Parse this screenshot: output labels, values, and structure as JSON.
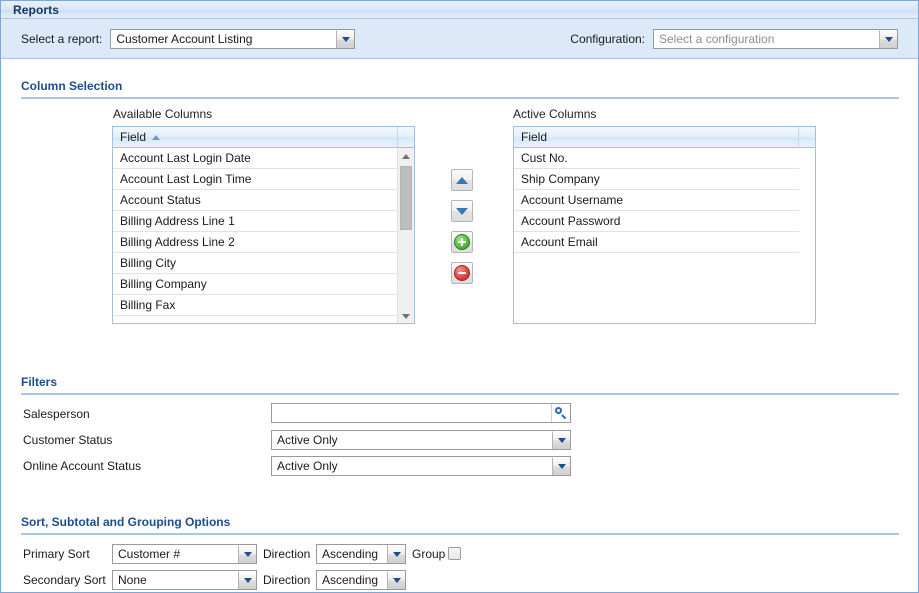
{
  "window": {
    "title": "Reports"
  },
  "toolbar": {
    "report_label": "Select a report:",
    "report_value": "Customer Account Listing",
    "configuration_label": "Configuration:",
    "configuration_placeholder": "Select a configuration"
  },
  "column_selection": {
    "heading": "Column Selection",
    "available": {
      "caption": "Available Columns",
      "header": "Field",
      "sort": "ascending",
      "items": [
        "Account Last Login Date",
        "Account Last Login Time",
        "Account Status",
        "Billing Address Line 1",
        "Billing Address Line 2",
        "Billing City",
        "Billing Company",
        "Billing Fax"
      ]
    },
    "active": {
      "caption": "Active Columns",
      "header": "Field",
      "items": [
        "Cust No.",
        "Ship Company",
        "Account Username",
        "Account Password",
        "Account Email"
      ]
    },
    "transfer_buttons": [
      {
        "name": "move-up-button",
        "icon": "triangle-up-icon"
      },
      {
        "name": "move-down-button",
        "icon": "triangle-down-icon"
      },
      {
        "name": "add-column-button",
        "icon": "plus-circle-icon"
      },
      {
        "name": "remove-column-button",
        "icon": "minus-circle-icon"
      }
    ]
  },
  "filters": {
    "heading": "Filters",
    "salesperson": {
      "label": "Salesperson",
      "value": "",
      "icon": "search-icon"
    },
    "customer_status": {
      "label": "Customer Status",
      "value": "Active Only"
    },
    "online_account_status": {
      "label": "Online Account Status",
      "value": "Active Only"
    }
  },
  "sort_options": {
    "heading": "Sort, Subtotal and Grouping Options",
    "primary": {
      "label": "Primary Sort",
      "value": "Customer #",
      "direction_label": "Direction",
      "direction_value": "Ascending",
      "group_label": "Group",
      "group_checked": false
    },
    "secondary": {
      "label": "Secondary Sort",
      "value": "None",
      "direction_label": "Direction",
      "direction_value": "Ascending"
    }
  },
  "colors": {
    "accent": "#1f4e8c",
    "header_bg": "#dce9f8",
    "rule": "#a8c6e6",
    "add": "#54b93a",
    "remove": "#d6453c"
  }
}
